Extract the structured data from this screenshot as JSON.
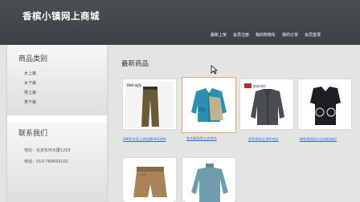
{
  "header": {
    "site_title": "香槟小镇网上商城",
    "nav": [
      "最新上架",
      "会员注册",
      "我的购物车",
      "我的订单",
      "会员登录"
    ]
  },
  "sidebar": {
    "categories_title": "商品类别",
    "categories": [
      "女上装",
      "女下装",
      "男上装",
      "男下装"
    ],
    "contact_title": "联系我们",
    "contact": [
      "地址：北京东环大厦1203",
      "电话：010-789564102"
    ]
  },
  "main": {
    "heading": "最新商品",
    "products": [
      {
        "link": "ONI秋冬男上休闲裤HK3400",
        "brand": "BNH 纯净"
      },
      {
        "link": "秋冬新款男士夹克衫",
        "brand": ""
      },
      {
        "link": "男色休闲立领夹克衫",
        "brand": "虹虹衬衫"
      },
      {
        "link": "韩版潮流加卡哇绒短袖衫",
        "brand": ""
      },
      {
        "link": "",
        "brand": ""
      },
      {
        "link": "",
        "brand": ""
      }
    ]
  },
  "colors": {
    "header_bg": "#3f4344",
    "page_bg": "#e3e5e3",
    "link": "#2a6fc9",
    "active_border": "#e8a27a"
  }
}
